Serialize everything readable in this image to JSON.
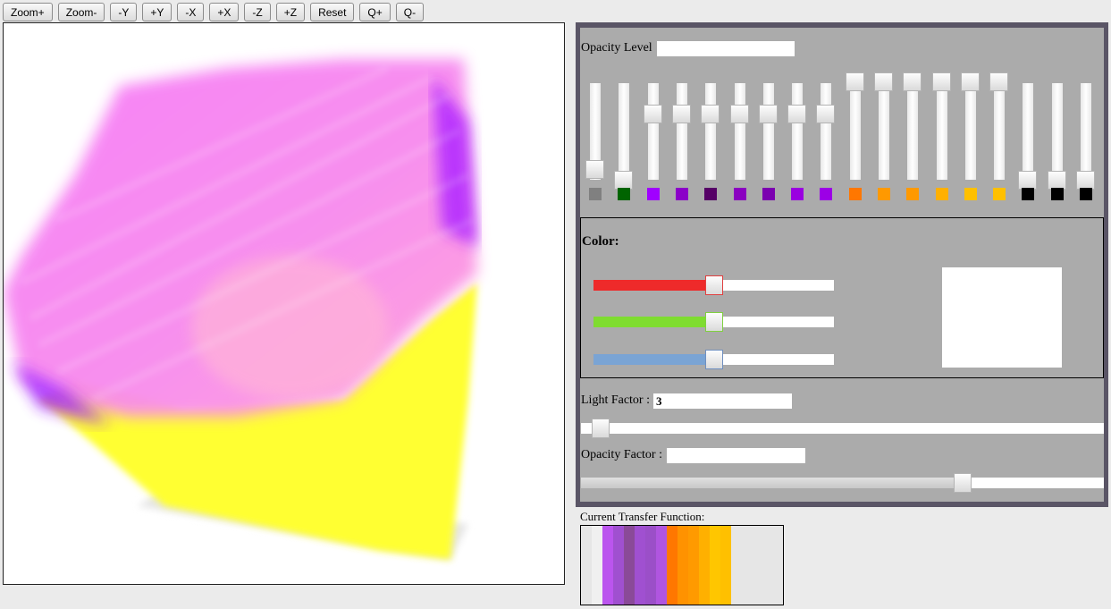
{
  "toolbar": {
    "buttons": [
      {
        "id": "zoom-in",
        "label": "Zoom+"
      },
      {
        "id": "zoom-out",
        "label": "Zoom-"
      },
      {
        "id": "minus-y",
        "label": "-Y"
      },
      {
        "id": "plus-y",
        "label": "+Y"
      },
      {
        "id": "minus-x",
        "label": "-X"
      },
      {
        "id": "plus-x",
        "label": "+X"
      },
      {
        "id": "minus-z",
        "label": "-Z"
      },
      {
        "id": "plus-z",
        "label": "+Z"
      },
      {
        "id": "reset",
        "label": "Reset"
      },
      {
        "id": "q-plus",
        "label": "Q+"
      },
      {
        "id": "q-minus",
        "label": "Q-"
      }
    ]
  },
  "opacity": {
    "label": "Opacity Level",
    "value": "",
    "sliders": [
      {
        "color": "#808080",
        "level": 0.12
      },
      {
        "color": "#006400",
        "level": 0.0
      },
      {
        "color": "#a000ff",
        "level": 0.68
      },
      {
        "color": "#8b00c8",
        "level": 0.68
      },
      {
        "color": "#550066",
        "level": 0.68
      },
      {
        "color": "#8a00c0",
        "level": 0.68
      },
      {
        "color": "#7b00b0",
        "level": 0.68
      },
      {
        "color": "#9a00e0",
        "level": 0.68
      },
      {
        "color": "#9c00e6",
        "level": 0.68
      },
      {
        "color": "#ff7700",
        "level": 1.0
      },
      {
        "color": "#ff9900",
        "level": 1.0
      },
      {
        "color": "#ff9900",
        "level": 1.0
      },
      {
        "color": "#ffb000",
        "level": 1.0
      },
      {
        "color": "#ffc000",
        "level": 1.0
      },
      {
        "color": "#ffc000",
        "level": 1.0
      },
      {
        "color": "#000000",
        "level": 0.0
      },
      {
        "color": "#000000",
        "level": 0.0
      },
      {
        "color": "#000000",
        "level": 0.0
      }
    ]
  },
  "color": {
    "label": "Color:",
    "red": 0.5,
    "green": 0.5,
    "blue": 0.5,
    "preview": "#ffffff"
  },
  "light": {
    "label": "Light Factor :",
    "value": "3",
    "level": 0.02
  },
  "opacity_factor": {
    "label": "Opacity Factor :",
    "value": "",
    "level": 0.73
  },
  "transfer": {
    "label": "Current Transfer Function:",
    "bands": [
      {
        "color": "#e6e6e6",
        "w": 12
      },
      {
        "color": "#f0f0f0",
        "w": 12
      },
      {
        "color": "#bb55ee",
        "w": 12
      },
      {
        "color": "#a050d0",
        "w": 12
      },
      {
        "color": "#8a4a98",
        "w": 12
      },
      {
        "color": "#a050d0",
        "w": 12
      },
      {
        "color": "#9b4fc8",
        "w": 12
      },
      {
        "color": "#b055e0",
        "w": 12
      },
      {
        "color": "#ff7700",
        "w": 12
      },
      {
        "color": "#ff9200",
        "w": 12
      },
      {
        "color": "#ff9a00",
        "w": 12
      },
      {
        "color": "#ffb000",
        "w": 12
      },
      {
        "color": "#ffc600",
        "w": 12
      },
      {
        "color": "#ffc000",
        "w": 12
      },
      {
        "color": "#e6e6e6",
        "w": 40
      }
    ]
  }
}
